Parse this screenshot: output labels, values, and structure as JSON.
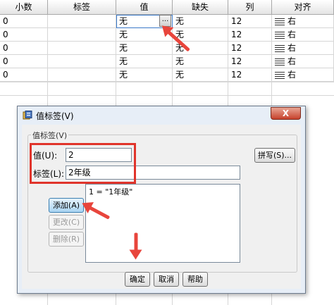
{
  "grid": {
    "columns": [
      "小数",
      "标签",
      "值",
      "缺失",
      "列",
      "对齐"
    ],
    "rows": [
      {
        "decimals": "0",
        "label": "",
        "values": "无",
        "missing": "无",
        "width": "12",
        "align": "右"
      },
      {
        "decimals": "0",
        "label": "",
        "values": "无",
        "missing": "无",
        "width": "12",
        "align": "右"
      },
      {
        "decimals": "0",
        "label": "",
        "values": "无",
        "missing": "无",
        "width": "12",
        "align": "右"
      },
      {
        "decimals": "0",
        "label": "",
        "values": "无",
        "missing": "无",
        "width": "12",
        "align": "右"
      },
      {
        "decimals": "0",
        "label": "",
        "values": "无",
        "missing": "无",
        "width": "12",
        "align": "右"
      }
    ],
    "ellipsis": "..."
  },
  "dialog": {
    "title": "值标签(V)",
    "close_label": "X",
    "group_label": "值标签(V)",
    "value_label": "值(U):",
    "value_input": "2",
    "label_label": "标签(L):",
    "label_input": "2年级",
    "spell_button": "拼写(S)...",
    "list_items": [
      "1 = \"1年级\""
    ],
    "add_button": "添加(A)",
    "change_button": "更改(C)",
    "remove_button": "删除(R)",
    "ok_button": "确定",
    "cancel_button": "取消",
    "help_button": "帮助"
  },
  "colors": {
    "annotation_red": "#e0342b",
    "dialog_border": "#6d7b8d",
    "close_button": "#c6412b"
  }
}
